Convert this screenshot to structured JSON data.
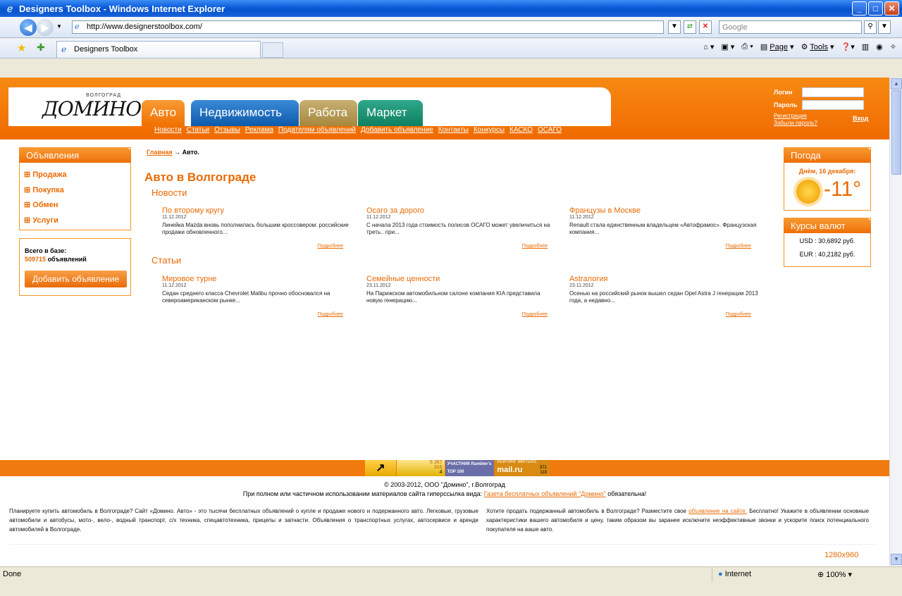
{
  "window": {
    "title": "Designers Toolbox - Windows Internet Explorer"
  },
  "address": {
    "url": "http://www.designerstoolbox.com/",
    "search_placeholder": "Google"
  },
  "tabs": {
    "active_label": "Designers Toolbox"
  },
  "commandbar": {
    "page": "Page",
    "tools": "Tools"
  },
  "site": {
    "logo_small": "ВОЛГОГРАД",
    "logo": "ДОМИНО",
    "main_tabs": [
      "Авто",
      "Недвижимость",
      "Работа",
      "Маркет"
    ],
    "subnav": [
      "Новости",
      "Статьи",
      "Отзывы",
      "Реклама",
      "Подателям объявлений",
      "Добавить объявление",
      "Контакты",
      "Конкурсы",
      "КАСКО",
      "ОСАГО"
    ],
    "login_label": "Логин",
    "password_label": "Пароль",
    "register": "Регистрация",
    "forgot": "Забыли пароль?",
    "enter": "Вход"
  },
  "left": {
    "ads_title": "Объявления",
    "categories": [
      "⊞ Продажа",
      "⊞ Покупка",
      "⊞ Обмен",
      "⊞ Услуги"
    ],
    "total_label": "Всего в базе:",
    "total_count": "509715",
    "total_suffix": "объявлений",
    "add_button": "Добавить объявление"
  },
  "breadcrumb": {
    "home": "Главная",
    "arrow": "→",
    "current": "Авто."
  },
  "main": {
    "title": "Авто в Волгограде",
    "news_title": "Новости",
    "articles_title": "Статьи",
    "more": "Подробнее",
    "news": [
      {
        "title": "По второму кругу",
        "date": "11.12.2012",
        "text": "Линейка Mazda вновь пополнилась большим кроссовером: российские продажи обновленного..."
      },
      {
        "title": "Осаго за дорого",
        "date": "11.12.2012",
        "text": "С начала 2013 года стоимость полисов ОСАГО может увеличиться на треть.. при..."
      },
      {
        "title": "Французы в Москве",
        "date": "11.12.2012",
        "text": "Renault стала единственным владельцем «Автофрамос». Французская компания..."
      }
    ],
    "articles": [
      {
        "title": "Мировое турне",
        "date": "11.12.2012",
        "text": "Седан среднего класса Chevrolet Malibu прочно обосновался на североамериканском рынке..."
      },
      {
        "title": "Семейные ценности",
        "date": "23.11.2012",
        "text": "На Парижском автомобильном салоне компания KIA представила новую генерацию..."
      },
      {
        "title": "Astraлогия",
        "date": "23.11.2012",
        "text": "Осенью на российский рынок вышел седан Opel Astra J генерации 2013 года, а недавно..."
      }
    ]
  },
  "right": {
    "weather_title": "Погода",
    "weather_date": "Днём, 16 декабря:",
    "temperature": "-11°",
    "rates_title": "Курсы валют",
    "usd": "USD : 30,6892 руб.",
    "eur": "EUR : 40,2182 руб."
  },
  "counters": {
    "c1": "5 267",
    "c2": "316",
    "c3": "4",
    "rambler": "УЧАСТНИК Rambler's TOP 100",
    "mail_top": "РЕЙТИНГ 66975201",
    "mail_a": "371",
    "mail_b": "119",
    "mail": "mail.ru"
  },
  "footer": {
    "copyright": "© 2003-2012, ООО \"Домино\", г.Волгоград",
    "reprint_text": "При полном или частичном использовании материалов сайта гиперссылка вида:",
    "reprint_link": "Газета бесплатных объявлений \"Домино\"",
    "reprint_end": "обязательна!",
    "seo_left": "Планируете купить автомобиль в Волгограде? Сайт «Домино. Авто» - это тысячи бесплатных объявлений о купле и продаже нового и подержанного авто. Легковые, грузовые автомобили и автобусы, мото-, вело-, водный транспорт, с/х техника, спецавтотехника, прицепы и запчасти. Объявления о транспортных услугах, автосервисе и аренде автомобилей в Волгограде.",
    "seo_right_a": "Хотите продать подержанный автомобиль в Волгограде? Разместите свое",
    "seo_right_link": "объявление на сайте.",
    "seo_right_b": "Бесплатно! Укажите в объявлении основные характеристики вашего автомобиля и цену, таким образом вы заранее исключите неэффективные звонки и ускорите поиск потенциального покупателя на ваше авто.",
    "resolution": "1280x960"
  },
  "status": {
    "left": "Done",
    "zone": "Internet",
    "zoom": "100%"
  }
}
